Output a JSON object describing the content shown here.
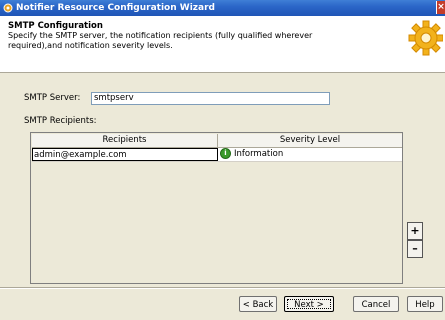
{
  "window": {
    "title": "Notifier Resource Configuration Wizard",
    "close_glyph": "×"
  },
  "header": {
    "title": "SMTP Configuration",
    "description": "Specify the SMTP server, the notification recipients (fully qualified wherever required),and notification severity levels.",
    "icon": "gear-icon"
  },
  "smtp": {
    "server_label": "SMTP Server:",
    "server_value": "smtpserv",
    "recipients_label": "SMTP Recipients:"
  },
  "table": {
    "columns": [
      "Recipients",
      "Severity Level"
    ],
    "rows": [
      {
        "recipient": "admin@example.com",
        "severity": "Information",
        "severity_glyph": "i"
      }
    ]
  },
  "side_buttons": {
    "add": "+",
    "remove": "–"
  },
  "footer": {
    "back": "< Back",
    "next": "Next >",
    "cancel": "Cancel",
    "help": "Help"
  },
  "colors": {
    "titlebar": "#2b66c8",
    "severity_info": "#3a9a2a"
  }
}
